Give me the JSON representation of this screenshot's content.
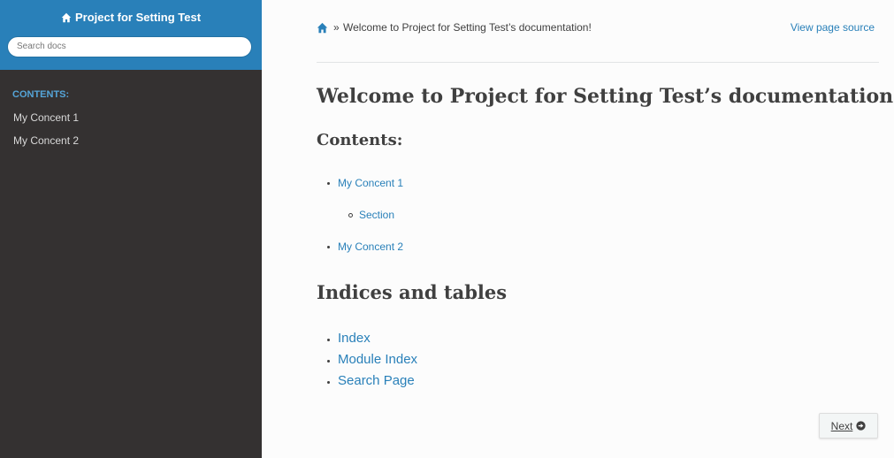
{
  "sidebar": {
    "project_title": "Project for Setting Test",
    "search_placeholder": "Search docs",
    "caption": "CONTENTS:",
    "items": [
      {
        "label": "My Concent 1"
      },
      {
        "label": "My Concent 2"
      }
    ]
  },
  "breadcrumb": {
    "separator": "»",
    "current": "Welcome to Project for Setting Test’s documentation!",
    "view_source": "View page source"
  },
  "content": {
    "title": "Welcome to Project for Setting Test’s documentation!",
    "contents_heading": "Contents:",
    "toc": [
      {
        "label": "My Concent 1",
        "children": [
          {
            "label": "Section"
          }
        ]
      },
      {
        "label": "My Concent 2"
      }
    ],
    "indices_heading": "Indices and tables",
    "indices": [
      {
        "label": "Index"
      },
      {
        "label": "Module Index"
      },
      {
        "label": "Search Page"
      }
    ]
  },
  "footer": {
    "next_label": "Next"
  },
  "colors": {
    "accent": "#2980b9",
    "sidebar_bg": "#343131",
    "caption": "#55a5d9"
  },
  "icons": [
    "home-icon",
    "arrow-circle-right-icon"
  ]
}
